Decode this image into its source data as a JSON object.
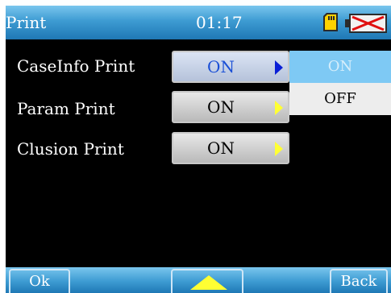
{
  "header": {
    "title": "Print",
    "time": "01:17",
    "icons": [
      "sd-card-icon",
      "battery-empty-icon"
    ]
  },
  "settings": [
    {
      "label": "CaseInfo Print",
      "value": "ON",
      "active": true
    },
    {
      "label": "Param Print",
      "value": "ON",
      "active": false
    },
    {
      "label": "Clusion Print",
      "value": "ON",
      "active": false
    }
  ],
  "dropdown": {
    "options": [
      "ON",
      "OFF"
    ],
    "selected": "ON"
  },
  "footer": {
    "ok_label": "Ok",
    "back_label": "Back",
    "up_icon": "up-arrow-icon"
  },
  "colors": {
    "bar_top": "#7ac6ee",
    "bar_bottom": "#1f78b5",
    "arrow_yellow": "#ffff33",
    "active_text": "#1a4fd6",
    "dropdown_selected": "#7ec9f4"
  }
}
